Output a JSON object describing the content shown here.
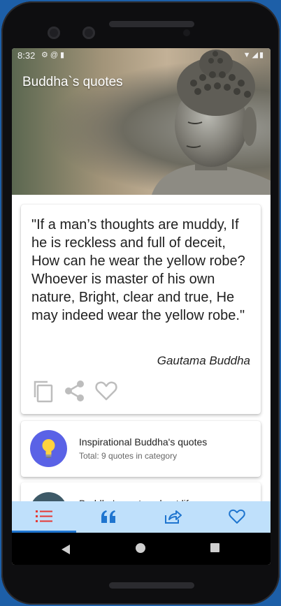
{
  "status_bar": {
    "time": "8:32",
    "left_icons": [
      "gear-icon",
      "at-icon",
      "sd-card-icon"
    ],
    "right_icons": [
      "wifi-icon",
      "signal-icon",
      "battery-icon"
    ]
  },
  "header": {
    "title": "Buddha`s quotes"
  },
  "quote_card": {
    "text": "\"If a man’s thoughts are muddy, If he is reckless and full of deceit, How can he wear the yellow robe? Whoever is master of his own nature, Bright, clear and true, He may indeed wear the yellow robe.\"",
    "author": "Gautama Buddha",
    "actions": [
      "copy-icon",
      "share-icon",
      "heart-icon"
    ]
  },
  "categories": [
    {
      "title": "Inspirational Buddha's quotes",
      "subtitle": "Total: 9 quotes in category",
      "avatar_color": "#5a62e6",
      "icon": "lightbulb-icon"
    },
    {
      "title": "Buddha's quotes about life",
      "avatar_color": "#3e5a68"
    }
  ],
  "bottom_nav": {
    "items": [
      "list-icon",
      "quote-icon",
      "share-icon",
      "heart-icon"
    ],
    "active_index": 0,
    "background": "#bfe0fb",
    "accent": "#1f75cf"
  },
  "system_nav": [
    "back-icon",
    "home-icon",
    "recents-icon"
  ]
}
